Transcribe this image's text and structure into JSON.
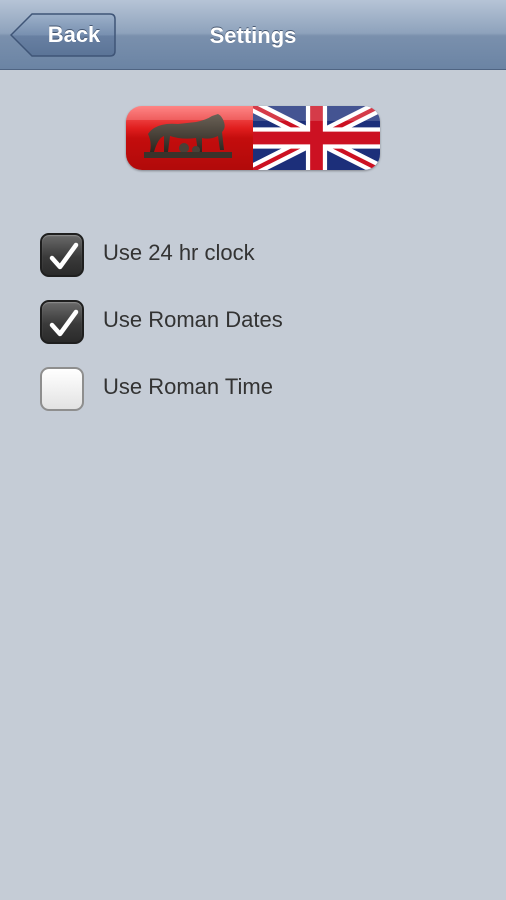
{
  "nav": {
    "back_label": "Back",
    "title": "Settings"
  },
  "language_toggle": {
    "left_icon": "capitoline-wolf-icon",
    "right_icon": "union-jack-flag-icon"
  },
  "options": [
    {
      "label": "Use 24 hr clock",
      "checked": true
    },
    {
      "label": "Use Roman Dates",
      "checked": true
    },
    {
      "label": "Use Roman Time",
      "checked": false
    }
  ],
  "colors": {
    "background": "#c5ccd6",
    "nav_bar": "#7a90ad",
    "roman_red": "#d01414",
    "checkbox_checked": "#3a3a3a"
  }
}
